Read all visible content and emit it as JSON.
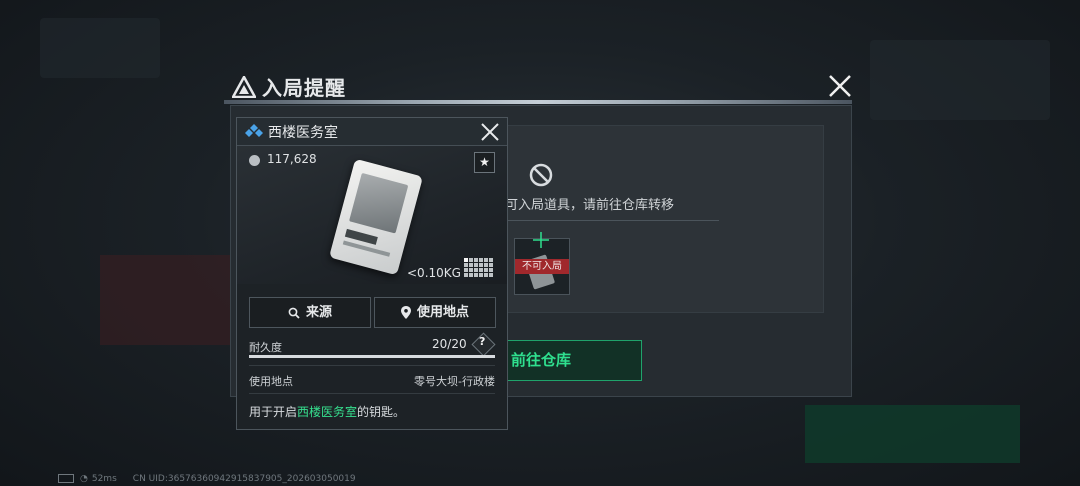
{
  "alert": {
    "title": "入局提醒",
    "message": "可入局道具，请前往仓库转移",
    "thumb_label": "不可入局",
    "goto_label": "前往仓库"
  },
  "card": {
    "title": "西楼医务室",
    "price": "117,628",
    "favorite": "★",
    "weight": "<0.10KG",
    "source_label": "来源",
    "location_btn_label": "使用地点",
    "durability_label": "耐久度",
    "durability_value": "20/20",
    "durability_fraction": 1.0,
    "help": "?",
    "use_location_label": "使用地点",
    "use_location_value": "零号大坝-行政楼",
    "desc_prefix": "用于开启",
    "desc_highlight": "西楼医务室",
    "desc_suffix": "的钥匙。"
  },
  "status": {
    "ping": "52ms",
    "uid": "CN UID:3657636094291583790​5_202603050019"
  },
  "colors": {
    "accent_green": "#2fe08f",
    "forbid_red": "#a0282c",
    "logo_blue": "#4aa3e8"
  },
  "icons": {
    "alert_logo": "warning-triangle-icon",
    "close": "close-icon",
    "forbid": "no-entry-icon",
    "card_logo": "diamond-cluster-icon",
    "coin": "coin-icon",
    "star": "star-icon",
    "search": "search-icon",
    "location": "location-pin-icon",
    "grid": "item-size-grid-icon"
  }
}
